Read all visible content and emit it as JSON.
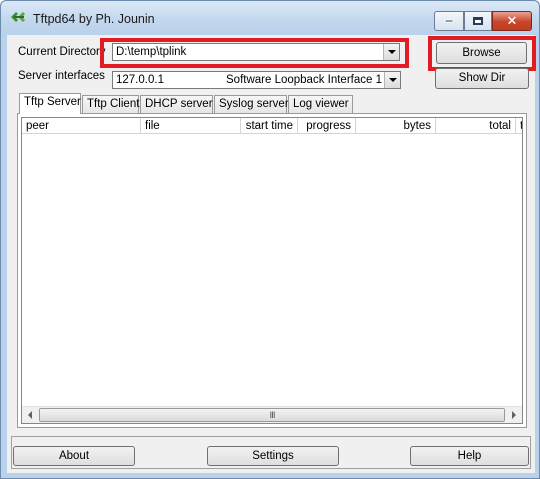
{
  "window": {
    "title": "Tftpd64 by Ph. Jounin",
    "close_glyph": "×"
  },
  "form": {
    "current_directory_label": "Current Directory",
    "current_directory_value": "D:\\temp\\tplink",
    "server_interfaces_label": "Server interfaces",
    "server_interface_ip": "127.0.0.1",
    "server_interface_name": "Software Loopback Interface 1",
    "browse_label": "Browse",
    "show_dir_label": "Show Dir"
  },
  "tabs": [
    {
      "label": "Tftp Server",
      "active": true
    },
    {
      "label": "Tftp Client",
      "active": false
    },
    {
      "label": "DHCP server",
      "active": false
    },
    {
      "label": "Syslog server",
      "active": false
    },
    {
      "label": "Log viewer",
      "active": false
    }
  ],
  "table": {
    "columns": [
      "peer",
      "file",
      "start time",
      "progress",
      "bytes",
      "total",
      "ti"
    ],
    "rows": []
  },
  "scrollbar": {
    "grip": "III"
  },
  "footer": {
    "about_label": "About",
    "settings_label": "Settings",
    "help_label": "Help"
  },
  "colors": {
    "highlight": "#e31b23",
    "window_frame": "#b9d1ea",
    "dialog_bg": "#f0f0f0"
  }
}
